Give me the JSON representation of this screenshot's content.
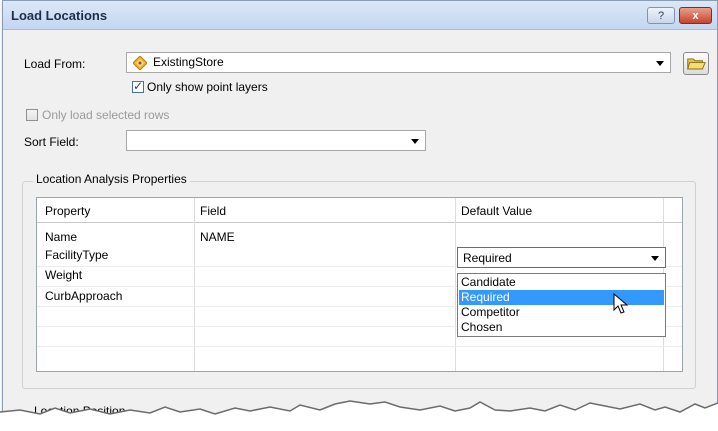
{
  "dialog": {
    "title": "Load Locations",
    "help_label": "?",
    "close_label": "x"
  },
  "load_from": {
    "label": "Load From:",
    "value": "ExistingStore",
    "icon": "store-layer-icon"
  },
  "only_point_layers": {
    "label": "Only show point layers",
    "checked": true
  },
  "only_selected_rows": {
    "label": "Only load selected rows",
    "checked": false,
    "enabled": false
  },
  "sort_field": {
    "label": "Sort Field:",
    "value": ""
  },
  "group": {
    "title": "Location Analysis Properties",
    "columns": [
      "Property",
      "Field",
      "Default Value"
    ],
    "rows": [
      {
        "property": "Name",
        "field": "NAME",
        "default": ""
      },
      {
        "property": "FacilityType",
        "field": "",
        "default": "Required"
      },
      {
        "property": "Weight",
        "field": "",
        "default": ""
      },
      {
        "property": "CurbApproach",
        "field": "",
        "default": ""
      }
    ]
  },
  "default_value_dropdown": {
    "selected": "Required",
    "options": [
      "Candidate",
      "Required",
      "Competitor",
      "Chosen"
    ],
    "highlighted": "Required"
  },
  "location_position": {
    "label": "Location Position"
  }
}
